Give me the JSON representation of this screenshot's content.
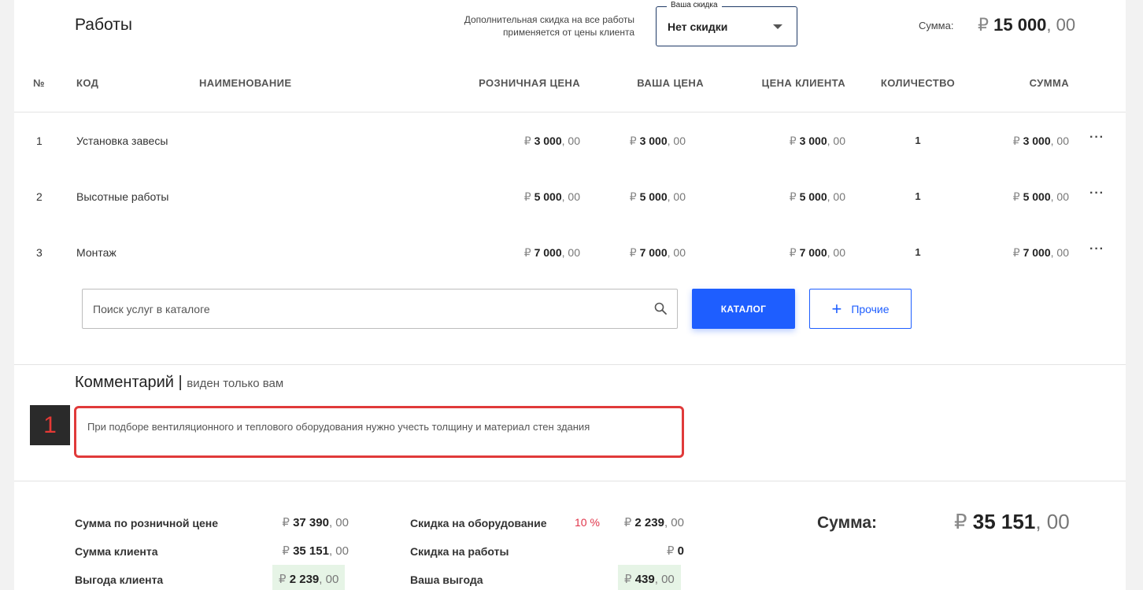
{
  "header": {
    "title": "Работы",
    "discount_note_line1": "Дополнительная скидка на все работы",
    "discount_note_line2": "применяется от цены клиента",
    "discount_select_label": "Ваша скидка",
    "discount_select_value": "Нет скидки",
    "sum_label": "Сумма:",
    "sum_currency": "₽",
    "sum_int": "15 000",
    "sum_dec": ", 00"
  },
  "table": {
    "columns": {
      "num": "№",
      "code": "КОД",
      "name": "НАИМЕНОВАНИЕ",
      "retail": "РОЗНИЧНАЯ ЦЕНА",
      "yours": "ВАША ЦЕНА",
      "client": "ЦЕНА КЛИЕНТА",
      "qty": "КОЛИЧЕСТВО",
      "sum": "СУММА"
    },
    "rows": [
      {
        "num": "1",
        "code": "Установка завесы",
        "retail": "3 000",
        "yours": "3 000",
        "client": "3 000",
        "qty": "1",
        "sum": "3 000"
      },
      {
        "num": "2",
        "code": "Высотные работы",
        "retail": "5 000",
        "yours": "5 000",
        "client": "5 000",
        "qty": "1",
        "sum": "5 000"
      },
      {
        "num": "3",
        "code": "Монтаж",
        "retail": "7 000",
        "yours": "7 000",
        "client": "7 000",
        "qty": "1",
        "sum": "7 000"
      }
    ],
    "currency": "₽",
    "dec": ", 00",
    "row_menu": "···"
  },
  "actions": {
    "search_placeholder": "Поиск услуг в каталоге",
    "catalog_label": "КАТАЛОГ",
    "other_plus": "+",
    "other_label": "Прочие"
  },
  "comment": {
    "title": "Комментарий",
    "separator": "|",
    "subtitle": "виден только вам",
    "text": "При подборе вентиляционного и теплового оборудования нужно учесть толщину и материал стен здания",
    "badge": "1"
  },
  "summary": {
    "retail_sum_label": "Сумма по розничной цене",
    "retail_sum_int": "37 390",
    "client_sum_label": "Сумма клиента",
    "client_sum_int": "35 151",
    "client_benefit_label": "Выгода клиента",
    "client_benefit_int": "2 239",
    "equipment_discount_label": "Скидка на оборудование",
    "equipment_discount_pct": "10 %",
    "equipment_discount_int": "2 239",
    "works_discount_label": "Скидка на работы",
    "works_discount_int": "0",
    "your_benefit_label": "Ваша выгода",
    "your_benefit_int": "439",
    "currency": "₽",
    "dec": ", 00",
    "total_label": "Сумма:",
    "total_int": "35 151",
    "total_dec": ", 00"
  },
  "colors": {
    "accent": "#1e5eff",
    "highlight_border": "#e03a3a",
    "badge_bg": "#2a2a2a",
    "percent": "#e0344a",
    "benefit_bg": "#e6f4e6"
  }
}
